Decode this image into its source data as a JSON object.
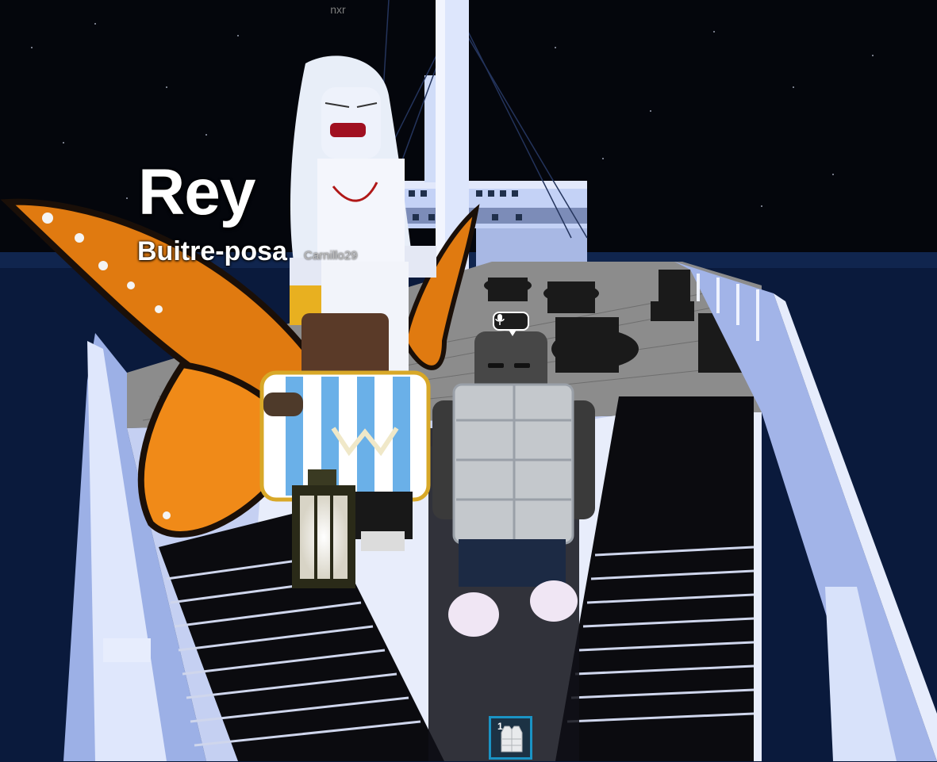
{
  "overlay": {
    "top_username": "nxr"
  },
  "nameplate": {
    "title": "Rey",
    "subtitle": "Buitre-posa",
    "player_name": "Carnillo29"
  },
  "voice_chat": {
    "icon": "microphone-icon"
  },
  "hotbar": {
    "slots": [
      {
        "number": "1",
        "icon": "puffer-vest-icon"
      }
    ]
  },
  "colors": {
    "night_sky": "#04060c",
    "ocean": "#0a1a3c",
    "ship_hull": "#b8c8f0",
    "hotbar_border": "#1a93c4"
  }
}
